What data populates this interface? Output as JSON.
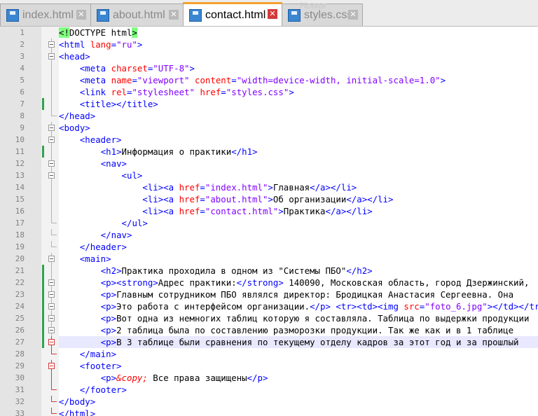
{
  "tabs": [
    {
      "name": "index.html",
      "active": false
    },
    {
      "name": "about.html",
      "active": false
    },
    {
      "name": "contact.html",
      "active": true
    },
    {
      "name": "styles.css",
      "active": false
    }
  ],
  "ghost_tab": "Новая",
  "lines": [
    {
      "n": 1,
      "fold": "none",
      "changed": false,
      "current": false,
      "seg": [
        [
          "d",
          "<!"
        ],
        [
          "t",
          "DOCTYPE html"
        ],
        [
          "d",
          ">"
        ]
      ]
    },
    {
      "n": 2,
      "fold": "open",
      "changed": false,
      "current": false,
      "seg": [
        [
          "k",
          "<html "
        ],
        [
          "a",
          "lang"
        ],
        [
          "k",
          "="
        ],
        [
          "v",
          "\"ru\""
        ],
        [
          "k",
          ">"
        ]
      ]
    },
    {
      "n": 3,
      "fold": "open",
      "changed": false,
      "current": false,
      "seg": [
        [
          "k",
          "<head>"
        ]
      ]
    },
    {
      "n": 4,
      "fold": "line",
      "changed": false,
      "current": false,
      "seg": [
        [
          "t",
          "    "
        ],
        [
          "k",
          "<meta "
        ],
        [
          "a",
          "charset"
        ],
        [
          "k",
          "="
        ],
        [
          "v",
          "\"UTF-8\""
        ],
        [
          "k",
          ">"
        ]
      ]
    },
    {
      "n": 5,
      "fold": "line",
      "changed": false,
      "current": false,
      "seg": [
        [
          "t",
          "    "
        ],
        [
          "k",
          "<meta "
        ],
        [
          "a",
          "name"
        ],
        [
          "k",
          "="
        ],
        [
          "v",
          "\"viewport\""
        ],
        [
          "k",
          " "
        ],
        [
          "a",
          "content"
        ],
        [
          "k",
          "="
        ],
        [
          "v",
          "\"width=device-width, initial-scale=1.0\""
        ],
        [
          "k",
          ">"
        ]
      ]
    },
    {
      "n": 6,
      "fold": "line",
      "changed": false,
      "current": false,
      "seg": [
        [
          "t",
          "    "
        ],
        [
          "k",
          "<link "
        ],
        [
          "a",
          "rel"
        ],
        [
          "k",
          "="
        ],
        [
          "v",
          "\"stylesheet\""
        ],
        [
          "k",
          " "
        ],
        [
          "a",
          "href"
        ],
        [
          "k",
          "="
        ],
        [
          "v",
          "\"styles.css\""
        ],
        [
          "k",
          ">"
        ]
      ]
    },
    {
      "n": 7,
      "fold": "line",
      "changed": true,
      "current": false,
      "seg": [
        [
          "t",
          "    "
        ],
        [
          "k",
          "<title></title>"
        ]
      ]
    },
    {
      "n": 8,
      "fold": "end",
      "changed": false,
      "current": false,
      "seg": [
        [
          "k",
          "</head>"
        ]
      ]
    },
    {
      "n": 9,
      "fold": "open",
      "changed": false,
      "current": false,
      "seg": [
        [
          "k",
          "<body>"
        ]
      ]
    },
    {
      "n": 10,
      "fold": "open",
      "changed": false,
      "current": false,
      "seg": [
        [
          "t",
          "    "
        ],
        [
          "k",
          "<header>"
        ]
      ]
    },
    {
      "n": 11,
      "fold": "line",
      "changed": true,
      "current": false,
      "seg": [
        [
          "t",
          "        "
        ],
        [
          "k",
          "<h1>"
        ],
        [
          "t",
          "Информация о практики"
        ],
        [
          "k",
          "</h1>"
        ]
      ]
    },
    {
      "n": 12,
      "fold": "open",
      "changed": false,
      "current": false,
      "seg": [
        [
          "t",
          "        "
        ],
        [
          "k",
          "<nav>"
        ]
      ]
    },
    {
      "n": 13,
      "fold": "open",
      "changed": false,
      "current": false,
      "seg": [
        [
          "t",
          "            "
        ],
        [
          "k",
          "<ul>"
        ]
      ]
    },
    {
      "n": 14,
      "fold": "line",
      "changed": false,
      "current": false,
      "seg": [
        [
          "t",
          "                "
        ],
        [
          "k",
          "<li><a "
        ],
        [
          "a",
          "href"
        ],
        [
          "k",
          "="
        ],
        [
          "v",
          "\"index.html\""
        ],
        [
          "k",
          ">"
        ],
        [
          "t",
          "Главная"
        ],
        [
          "k",
          "</a></li>"
        ]
      ]
    },
    {
      "n": 15,
      "fold": "line",
      "changed": false,
      "current": false,
      "seg": [
        [
          "t",
          "                "
        ],
        [
          "k",
          "<li><a "
        ],
        [
          "a",
          "href"
        ],
        [
          "k",
          "="
        ],
        [
          "v",
          "\"about.html\""
        ],
        [
          "k",
          ">"
        ],
        [
          "t",
          "Об организации"
        ],
        [
          "k",
          "</a></li>"
        ]
      ]
    },
    {
      "n": 16,
      "fold": "line",
      "changed": false,
      "current": false,
      "seg": [
        [
          "t",
          "                "
        ],
        [
          "k",
          "<li><a "
        ],
        [
          "a",
          "href"
        ],
        [
          "k",
          "="
        ],
        [
          "v",
          "\"contact.html\""
        ],
        [
          "k",
          ">"
        ],
        [
          "t",
          "Практика"
        ],
        [
          "k",
          "</a></li>"
        ]
      ]
    },
    {
      "n": 17,
      "fold": "end",
      "changed": false,
      "current": false,
      "seg": [
        [
          "t",
          "            "
        ],
        [
          "k",
          "</ul>"
        ]
      ]
    },
    {
      "n": 18,
      "fold": "end",
      "changed": false,
      "current": false,
      "seg": [
        [
          "t",
          "        "
        ],
        [
          "k",
          "</nav>"
        ]
      ]
    },
    {
      "n": 19,
      "fold": "end",
      "changed": false,
      "current": false,
      "seg": [
        [
          "t",
          "    "
        ],
        [
          "k",
          "</header>"
        ]
      ]
    },
    {
      "n": 20,
      "fold": "open",
      "changed": false,
      "current": false,
      "seg": [
        [
          "t",
          "    "
        ],
        [
          "k",
          "<main>"
        ]
      ]
    },
    {
      "n": 21,
      "fold": "line",
      "changed": true,
      "current": false,
      "seg": [
        [
          "t",
          "        "
        ],
        [
          "k",
          "<h2>"
        ],
        [
          "t",
          "Практика проходила в одном из \"Системы ПБО\""
        ],
        [
          "k",
          "</h2>"
        ]
      ]
    },
    {
      "n": 22,
      "fold": "open",
      "changed": true,
      "current": false,
      "seg": [
        [
          "t",
          "        "
        ],
        [
          "k",
          "<p><strong>"
        ],
        [
          "t",
          "Адрес практики:"
        ],
        [
          "k",
          "</strong>"
        ],
        [
          "t",
          " 140090, Московская область, город Дзержинский,"
        ]
      ]
    },
    {
      "n": 23,
      "fold": "open",
      "changed": true,
      "current": false,
      "seg": [
        [
          "t",
          "        "
        ],
        [
          "k",
          "<p>"
        ],
        [
          "t",
          "Главным сотрудником ПБО являлся директор: Бродицкая Анастасия Сергеевна. Она"
        ]
      ]
    },
    {
      "n": 24,
      "fold": "open",
      "changed": true,
      "current": false,
      "seg": [
        [
          "t",
          "        "
        ],
        [
          "k",
          "<p>"
        ],
        [
          "t",
          "Это работа с интерфейсом организации."
        ],
        [
          "k",
          "</p>"
        ],
        [
          "t",
          " "
        ],
        [
          "k",
          "<tr><td><img "
        ],
        [
          "a",
          "src"
        ],
        [
          "k",
          "="
        ],
        [
          "v",
          "\"foto_6.jpg\""
        ],
        [
          "k",
          "></td></tr>"
        ]
      ]
    },
    {
      "n": 25,
      "fold": "open",
      "changed": true,
      "current": false,
      "seg": [
        [
          "t",
          "        "
        ],
        [
          "k",
          "<p>"
        ],
        [
          "t",
          "Вот одна из немногих таблиц которую я составляла. Таблица по выдержки продукции"
        ]
      ]
    },
    {
      "n": 26,
      "fold": "open",
      "changed": true,
      "current": false,
      "seg": [
        [
          "t",
          "        "
        ],
        [
          "k",
          "<p>"
        ],
        [
          "t",
          "2 таблица была по составлению разморозки продукции. Так же как и в 1 таблице"
        ]
      ]
    },
    {
      "n": 27,
      "fold": "openred",
      "changed": true,
      "current": true,
      "seg": [
        [
          "t",
          "        "
        ],
        [
          "k",
          "<p>"
        ],
        [
          "t",
          "В 3 таблице были сравнения по текущему отделу кадров за этот год и за прошлый"
        ]
      ]
    },
    {
      "n": 28,
      "fold": "endred",
      "changed": false,
      "current": false,
      "seg": [
        [
          "t",
          "    "
        ],
        [
          "k",
          "</main>"
        ]
      ]
    },
    {
      "n": 29,
      "fold": "openred",
      "changed": false,
      "current": false,
      "seg": [
        [
          "t",
          "    "
        ],
        [
          "k",
          "<footer>"
        ]
      ]
    },
    {
      "n": 30,
      "fold": "linered",
      "changed": false,
      "current": false,
      "seg": [
        [
          "t",
          "        "
        ],
        [
          "k",
          "<p>"
        ],
        [
          "e",
          "&copy;"
        ],
        [
          "t",
          " Все права защищены"
        ],
        [
          "k",
          "</p>"
        ]
      ]
    },
    {
      "n": 31,
      "fold": "endred",
      "changed": false,
      "current": false,
      "seg": [
        [
          "t",
          "    "
        ],
        [
          "k",
          "</footer>"
        ]
      ]
    },
    {
      "n": 32,
      "fold": "endred",
      "changed": false,
      "current": false,
      "seg": [
        [
          "k",
          "</body>"
        ]
      ]
    },
    {
      "n": 33,
      "fold": "endred",
      "changed": false,
      "current": false,
      "seg": [
        [
          "k",
          "</html>"
        ]
      ]
    }
  ]
}
